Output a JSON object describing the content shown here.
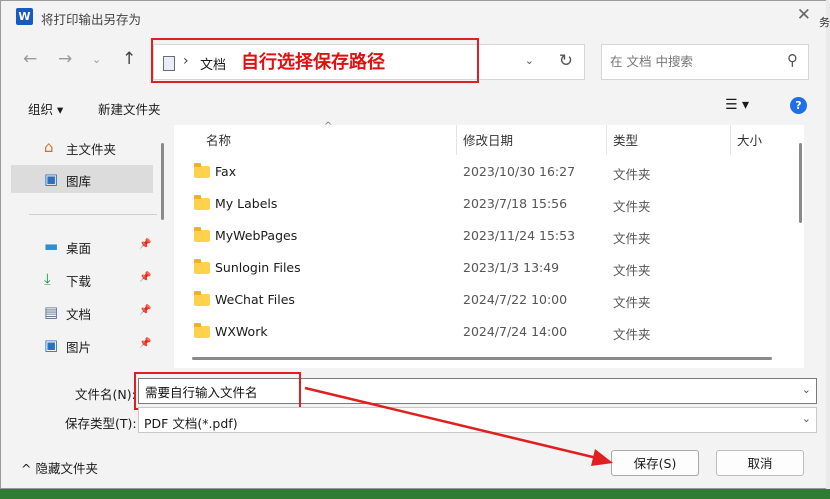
{
  "window": {
    "title": "将打印输出另存为",
    "app_icon_letter": "W"
  },
  "address": {
    "crumb": "文档"
  },
  "annotation": {
    "path_note": "自行选择保存路径"
  },
  "search": {
    "placeholder": "在 文档 中搜索"
  },
  "toolbar": {
    "organize": "组织 ▾",
    "new_folder": "新建文件夹"
  },
  "nav": {
    "items": [
      {
        "label": "主文件夹",
        "icon": "home-icon"
      },
      {
        "label": "图库",
        "icon": "gallery-icon"
      },
      {
        "label": "桌面",
        "icon": "desktop-icon"
      },
      {
        "label": "下载",
        "icon": "download-icon"
      },
      {
        "label": "文档",
        "icon": "document-icon"
      },
      {
        "label": "图片",
        "icon": "pictures-icon"
      }
    ]
  },
  "files": {
    "columns": [
      "名称",
      "修改日期",
      "类型",
      "大小"
    ],
    "rows": [
      {
        "name": "Fax",
        "date": "2023/10/30 16:27",
        "type": "文件夹"
      },
      {
        "name": "My Labels",
        "date": "2023/7/18 15:56",
        "type": "文件夹"
      },
      {
        "name": "MyWebPages",
        "date": "2023/11/24 15:53",
        "type": "文件夹"
      },
      {
        "name": "Sunlogin Files",
        "date": "2023/1/3 13:49",
        "type": "文件夹"
      },
      {
        "name": "WeChat Files",
        "date": "2024/7/22 10:00",
        "type": "文件夹"
      },
      {
        "name": "WXWork",
        "date": "2024/7/24 14:00",
        "type": "文件夹"
      }
    ]
  },
  "form": {
    "filename_label": "文件名(N):",
    "filename_value": "需要自行输入文件名",
    "filetype_label": "保存类型(T):",
    "filetype_value": "PDF 文档(*.pdf)"
  },
  "footer": {
    "hide_folders": "隐藏文件夹",
    "save": "保存(S)",
    "cancel": "取消"
  },
  "colors": {
    "annotation": "#e02020",
    "help": "#1f6feb",
    "folder": "#ffd24c"
  },
  "edge_text": "务"
}
